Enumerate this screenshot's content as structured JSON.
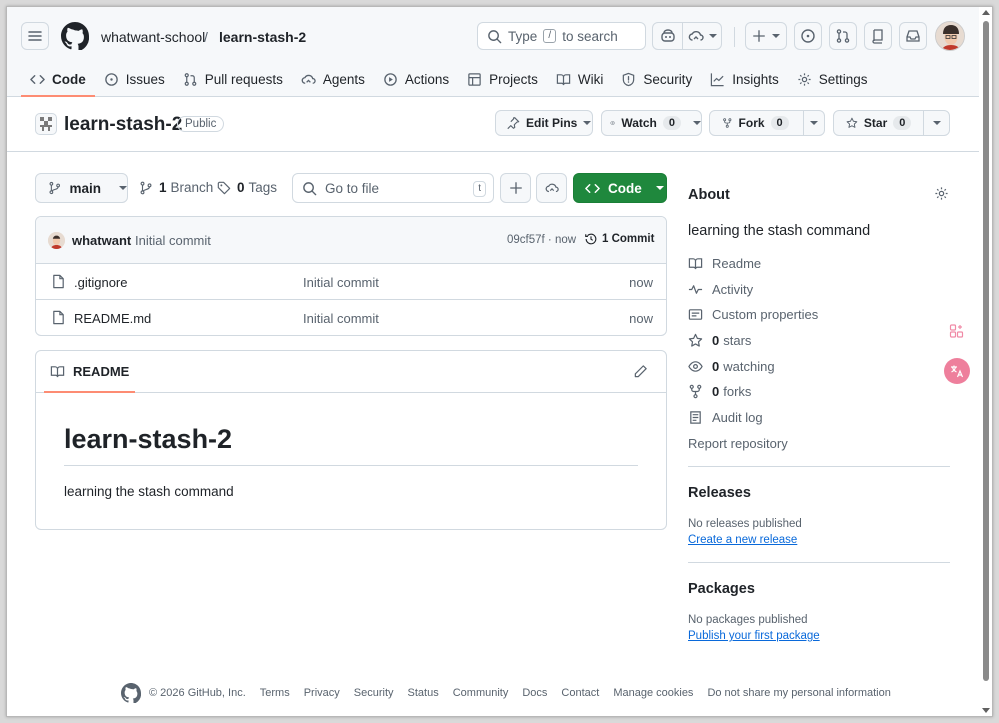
{
  "header": {
    "owner": "whatwant-school",
    "separator": "/",
    "repo": "learn-stash-2",
    "search_prefix": "Type",
    "search_key": "/",
    "search_suffix": "to search"
  },
  "tabs": [
    {
      "label": "Code",
      "icon": "code-icon"
    },
    {
      "label": "Issues",
      "icon": "issue-icon"
    },
    {
      "label": "Pull requests",
      "icon": "pull-request-icon"
    },
    {
      "label": "Agents",
      "icon": "agent-icon"
    },
    {
      "label": "Actions",
      "icon": "play-icon"
    },
    {
      "label": "Projects",
      "icon": "table-icon"
    },
    {
      "label": "Wiki",
      "icon": "book-icon"
    },
    {
      "label": "Security",
      "icon": "shield-icon"
    },
    {
      "label": "Insights",
      "icon": "graph-icon"
    },
    {
      "label": "Settings",
      "icon": "gear-icon"
    }
  ],
  "repohead": {
    "name": "learn-stash-2",
    "visibility": "Public",
    "edit_pins": "Edit Pins",
    "watch": "Watch",
    "watch_count": "0",
    "fork": "Fork",
    "fork_count": "0",
    "star": "Star",
    "star_count": "0"
  },
  "toolbar": {
    "branch": "main",
    "branch_count": "1",
    "branch_label": "Branch",
    "tag_count": "0",
    "tag_label": "Tags",
    "goto_placeholder": "Go to file",
    "goto_key": "t",
    "code_label": "Code"
  },
  "commit": {
    "author": "whatwant",
    "message": "Initial commit",
    "hash_time": "09cf57f · now",
    "count_label": "1 Commit"
  },
  "files": [
    {
      "name": ".gitignore",
      "message": "Initial commit",
      "time": "now"
    },
    {
      "name": "README.md",
      "message": "Initial commit",
      "time": "now"
    }
  ],
  "readme": {
    "tab_label": "README",
    "heading": "learn-stash-2",
    "body": "learning the stash command"
  },
  "about": {
    "title": "About",
    "description": "learning the stash command",
    "readme": "Readme",
    "activity": "Activity",
    "custom": "Custom properties",
    "stars_count": "0",
    "stars_label": "stars",
    "watching_count": "0",
    "watching_label": "watching",
    "forks_count": "0",
    "forks_label": "forks",
    "audit": "Audit log",
    "report": "Report repository"
  },
  "releases": {
    "title": "Releases",
    "empty": "No releases published",
    "link": "Create a new release"
  },
  "packages": {
    "title": "Packages",
    "empty": "No packages published",
    "link": "Publish your first package"
  },
  "footer": {
    "copyright": "© 2026 GitHub, Inc.",
    "links": [
      "Terms",
      "Privacy",
      "Security",
      "Status",
      "Community",
      "Docs",
      "Contact",
      "Manage cookies",
      "Do not share my personal information"
    ]
  },
  "colors": {
    "accent_green": "#1f883d",
    "tab_underline": "#fd8c73",
    "link_blue": "#0969da"
  }
}
